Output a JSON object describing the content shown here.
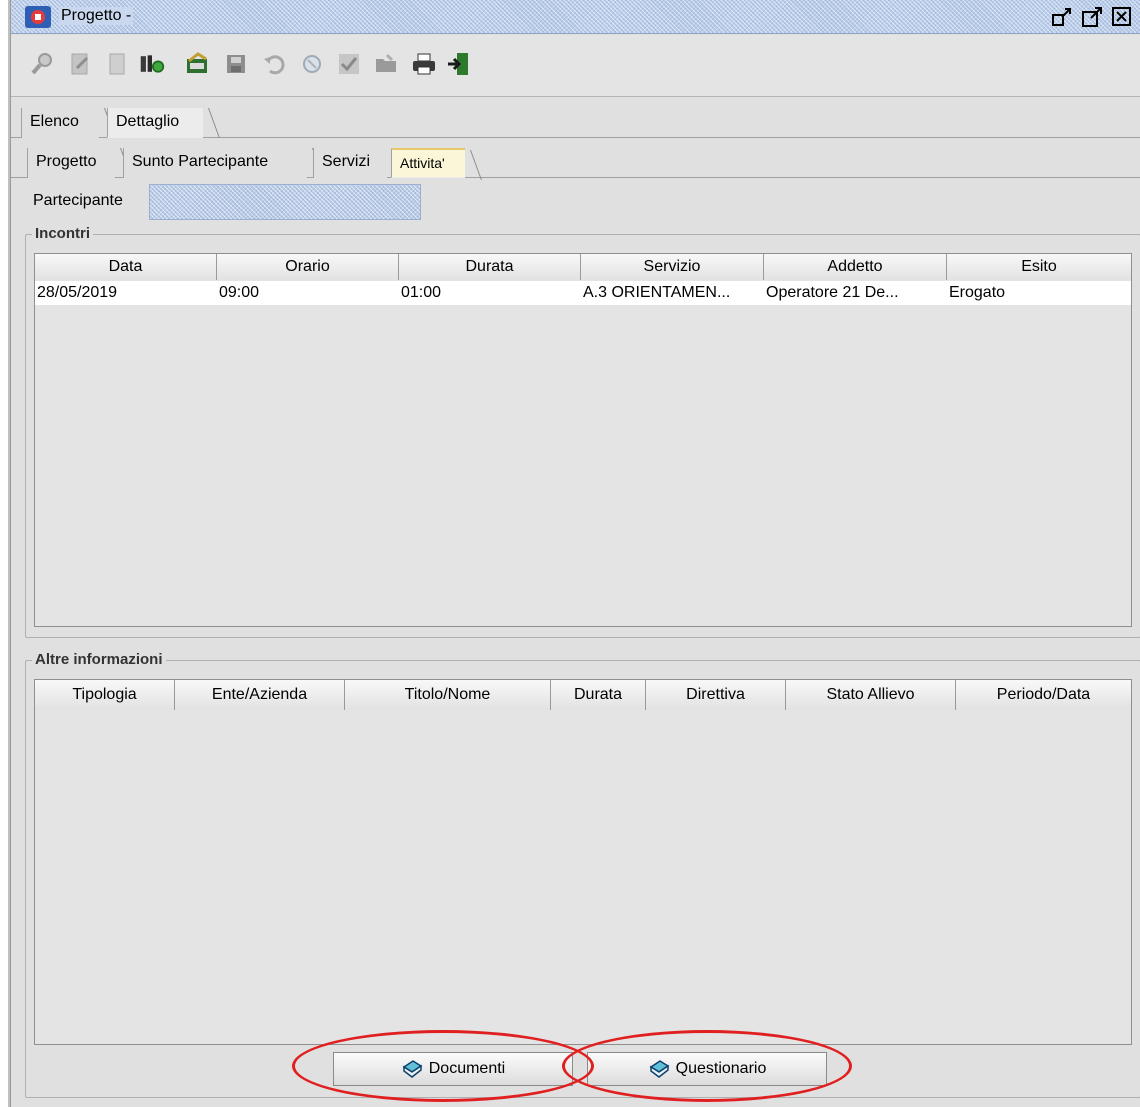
{
  "window": {
    "title": "Progetto -",
    "icon": "app-logo-icon",
    "controls": [
      "restore-icon",
      "maximize-icon",
      "close-icon"
    ],
    "accent": "#b8cbe8"
  },
  "toolbar": {
    "tools": [
      "search-icon",
      "edit-icon",
      "new-document-icon",
      "info-icon",
      "open-icon",
      "save-icon",
      "undo-icon",
      "refresh-icon",
      "validate-icon",
      "folder-icon",
      "print-icon",
      "exit-icon"
    ]
  },
  "tabs": {
    "main": [
      {
        "label": "Elenco"
      },
      {
        "label": "Dettaglio"
      }
    ],
    "main_active": "Dettaglio",
    "sub": [
      {
        "label": "Progetto"
      },
      {
        "label": "Sunto Partecipante"
      },
      {
        "label": "Servizi"
      },
      {
        "label": "Attivita'"
      }
    ],
    "sub_active": "Attivita'"
  },
  "participant": {
    "label": "Partecipante",
    "value": ""
  },
  "incontri": {
    "title": "Incontri",
    "columns": [
      "Data",
      "Orario",
      "Durata",
      "Servizio",
      "Addetto",
      "Esito"
    ],
    "rows": [
      [
        "28/05/2019",
        "09:00",
        "01:00",
        "A.3 ORIENTAMEN...",
        "Operatore 21 De...",
        "Erogato"
      ]
    ]
  },
  "altre": {
    "title": "Altre informazioni",
    "columns": [
      "Tipologia",
      "Ente/Azienda",
      "Titolo/Nome",
      "Durata",
      "Direttiva",
      "Stato Allievo",
      "Periodo/Data"
    ],
    "rows": []
  },
  "buttons": {
    "documenti": "Documenti",
    "questionario": "Questionario"
  },
  "highlight_color": "#e02020"
}
